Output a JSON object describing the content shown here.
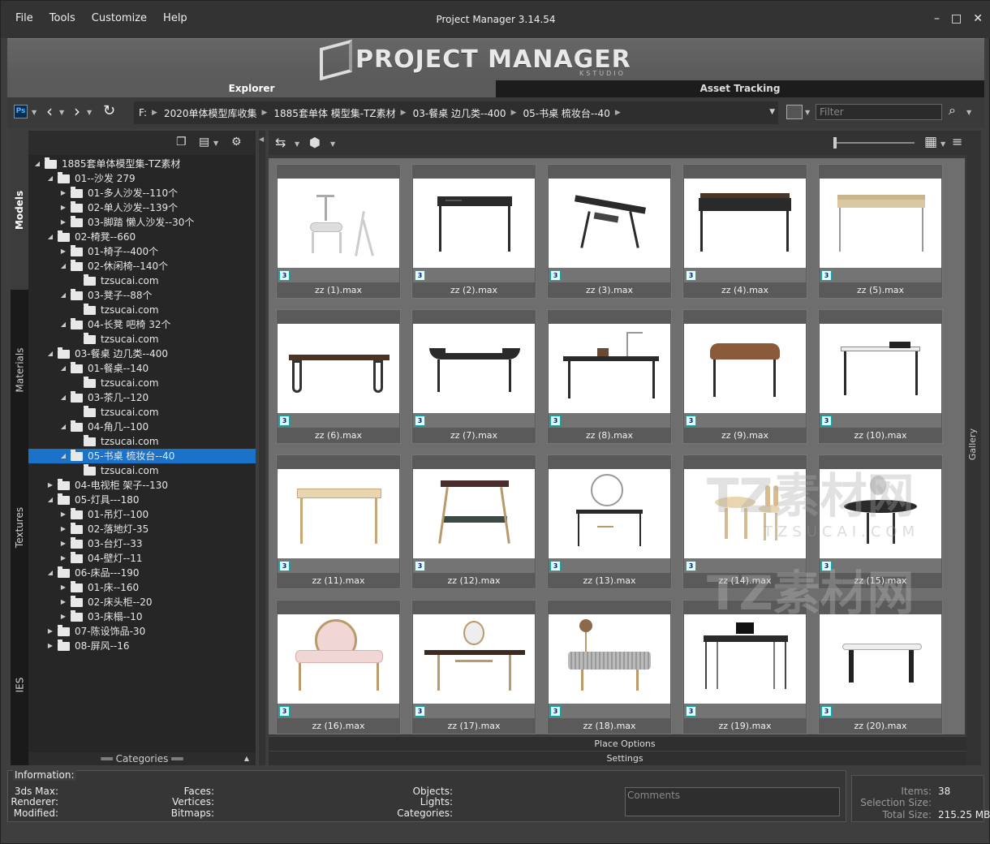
{
  "menu": [
    "File",
    "Tools",
    "Customize",
    "Help"
  ],
  "app_title": "Project Manager 3.14.54",
  "window_controls": {
    "minimize": "–",
    "maximize": "□",
    "close": "✕"
  },
  "logo": {
    "text": "PROJECT MANAGER",
    "sub": "KSTUDIO"
  },
  "tabs": {
    "explorer": "Explorer",
    "asset_tracking": "Asset Tracking"
  },
  "breadcrumb": [
    "F:",
    "2020单体模型库收集",
    "1885套单体 模型集-TZ素材",
    "03-餐桌 边几类--400",
    "05-书桌 梳妆台--40"
  ],
  "filter_placeholder": "Filter",
  "vertical_tabs": [
    "Models",
    "Materials",
    "Textures",
    "IES"
  ],
  "tree": [
    {
      "label": "1885套单体模型集-TZ素材",
      "level": 0,
      "arrow": "◢"
    },
    {
      "label": "01--沙发 279",
      "level": 1,
      "arrow": "◢"
    },
    {
      "label": "01-多人沙发--110个",
      "level": 2,
      "arrow": "▶"
    },
    {
      "label": "02-单人沙发--139个",
      "level": 2,
      "arrow": "▶"
    },
    {
      "label": "03-脚踏 懒人沙发--30个",
      "level": 2,
      "arrow": "▶"
    },
    {
      "label": "02-椅凳--660",
      "level": 1,
      "arrow": "◢"
    },
    {
      "label": "01-椅子--400个",
      "level": 2,
      "arrow": "▶"
    },
    {
      "label": "02-休闲椅--140个",
      "level": 2,
      "arrow": "◢"
    },
    {
      "label": "tzsucai.com",
      "level": 3,
      "arrow": ""
    },
    {
      "label": "03-凳子--88个",
      "level": 2,
      "arrow": "◢"
    },
    {
      "label": "tzsucai.com",
      "level": 3,
      "arrow": ""
    },
    {
      "label": "04-长凳 吧椅 32个",
      "level": 2,
      "arrow": "◢"
    },
    {
      "label": "tzsucai.com",
      "level": 3,
      "arrow": ""
    },
    {
      "label": "03-餐桌 边几类--400",
      "level": 1,
      "arrow": "◢"
    },
    {
      "label": "01-餐桌--140",
      "level": 2,
      "arrow": "◢"
    },
    {
      "label": "tzsucai.com",
      "level": 3,
      "arrow": ""
    },
    {
      "label": "03-茶几--120",
      "level": 2,
      "arrow": "◢"
    },
    {
      "label": "tzsucai.com",
      "level": 3,
      "arrow": ""
    },
    {
      "label": "04-角几--100",
      "level": 2,
      "arrow": "◢"
    },
    {
      "label": "tzsucai.com",
      "level": 3,
      "arrow": ""
    },
    {
      "label": "05-书桌 梳妆台--40",
      "level": 2,
      "arrow": "◢",
      "selected": true
    },
    {
      "label": "tzsucai.com",
      "level": 3,
      "arrow": ""
    },
    {
      "label": "04-电视柜 架子--130",
      "level": 1,
      "arrow": "▶"
    },
    {
      "label": "05-灯具---180",
      "level": 1,
      "arrow": "◢"
    },
    {
      "label": "01-吊灯--100",
      "level": 2,
      "arrow": "▶"
    },
    {
      "label": "02-落地灯-35",
      "level": 2,
      "arrow": "▶"
    },
    {
      "label": "03-台灯--33",
      "level": 2,
      "arrow": "▶"
    },
    {
      "label": "04-壁灯--11",
      "level": 2,
      "arrow": "▶"
    },
    {
      "label": "06-床品---190",
      "level": 1,
      "arrow": "◢"
    },
    {
      "label": "01-床--160",
      "level": 2,
      "arrow": "▶"
    },
    {
      "label": "02-床头柜--20",
      "level": 2,
      "arrow": "▶"
    },
    {
      "label": "03-床榻--10",
      "level": 2,
      "arrow": "▶"
    },
    {
      "label": "07-陈设饰品-30",
      "level": 1,
      "arrow": "▶"
    },
    {
      "label": "08-屏风--16",
      "level": 1,
      "arrow": "▶"
    }
  ],
  "categories_label": "Categories",
  "models": [
    {
      "name": "zz (1).max",
      "style": "stool"
    },
    {
      "name": "zz (2).max",
      "style": "black-desk"
    },
    {
      "name": "zz (3).max",
      "style": "splay-desk"
    },
    {
      "name": "zz (4).max",
      "style": "brown-desk"
    },
    {
      "name": "zz (5).max",
      "style": "gold-desk"
    },
    {
      "name": "zz (6).max",
      "style": "long-bench"
    },
    {
      "name": "zz (7).max",
      "style": "curve-desk"
    },
    {
      "name": "zz (8).max",
      "style": "lamp-desk"
    },
    {
      "name": "zz (9).max",
      "style": "round-desk"
    },
    {
      "name": "zz (10).max",
      "style": "white-desk"
    },
    {
      "name": "zz (11).max",
      "style": "wood-desk"
    },
    {
      "name": "zz (12).max",
      "style": "shelf-desk"
    },
    {
      "name": "zz (13).max",
      "style": "vanity-mirror"
    },
    {
      "name": "zz (14).max",
      "style": "kids-set"
    },
    {
      "name": "zz (15).max",
      "style": "oval-vanity"
    },
    {
      "name": "zz (16).max",
      "style": "pink-vanity"
    },
    {
      "name": "zz (17).max",
      "style": "walnut-vanity"
    },
    {
      "name": "zz (18).max",
      "style": "fluted-vanity"
    },
    {
      "name": "zz (19).max",
      "style": "wire-desk"
    },
    {
      "name": "zz (20).max",
      "style": "marble-desk"
    }
  ],
  "bottom_bars": {
    "place_options": "Place Options",
    "settings": "Settings"
  },
  "info": {
    "title": "Information:",
    "col1": [
      "3ds Max:",
      "Renderer:",
      "Modified:"
    ],
    "col2": [
      "Faces:",
      "Vertices:",
      "Bitmaps:"
    ],
    "col3": [
      "Objects:",
      "Lights:",
      "Categories:"
    ],
    "comments_placeholder": "Comments"
  },
  "stats": {
    "items_label": "Items:",
    "items_value": "38",
    "selection_label": "Selection Size:",
    "selection_value": "",
    "total_label": "Total Size:",
    "total_value": "215.25 MB"
  },
  "gallery_label": "Gallery",
  "watermark": {
    "title": "TZ素材网",
    "sub": "TZSUCAI.COM"
  }
}
